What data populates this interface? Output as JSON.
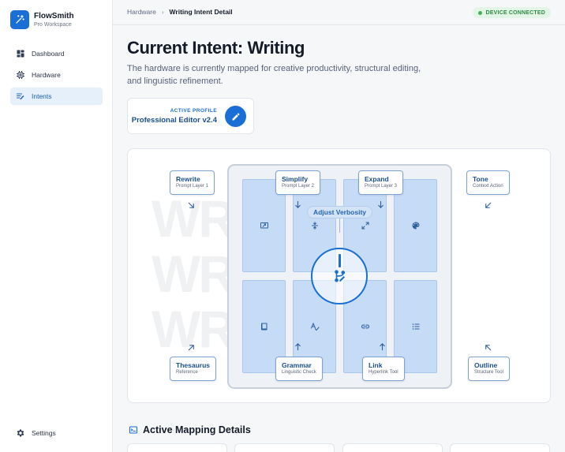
{
  "brand": {
    "name": "FlowSmith",
    "subtitle": "Pro Workspace",
    "logo_icon": "wand-icon",
    "accent": "#1a6fd6"
  },
  "nav": {
    "items": [
      {
        "label": "Dashboard",
        "icon": "dashboard-icon",
        "active": false
      },
      {
        "label": "Hardware",
        "icon": "chip-icon",
        "active": false
      },
      {
        "label": "Intents",
        "icon": "intents-icon",
        "active": true
      }
    ],
    "settings": {
      "label": "Settings",
      "icon": "gear-icon"
    }
  },
  "breadcrumb": {
    "parent": "Hardware",
    "separator": "›",
    "current": "Writing Intent Detail"
  },
  "status": {
    "label": "DEVICE CONNECTED",
    "color": "#3fb35a"
  },
  "page": {
    "title": "Current Intent: Writing",
    "description": "The hardware is currently mapped for creative productivity, structural editing, and linguistic refinement."
  },
  "profile": {
    "label": "ACTIVE PROFILE",
    "name": "Professional Editor v2.4",
    "edit_icon": "pencil-icon"
  },
  "device": {
    "watermark": [
      "WR",
      "WR",
      "WR"
    ],
    "dial": {
      "label": "Adjust Verbosity",
      "icon": "branch-edit-icon"
    },
    "keys_top": [
      "screen-share-icon",
      "format-line-spacing-icon",
      "expand-icon",
      "palette-icon"
    ],
    "keys_bottom": [
      "book-icon",
      "spellcheck-icon",
      "link-icon",
      "list-icon"
    ],
    "labels": {
      "rewrite": {
        "title": "Rewrite",
        "sub": "Prompt Layer 1"
      },
      "simplify": {
        "title": "Simplify",
        "sub": "Prompt Layer 2"
      },
      "expand": {
        "title": "Expand",
        "sub": "Prompt Layer 3"
      },
      "tone": {
        "title": "Tone",
        "sub": "Context Action"
      },
      "thesaurus": {
        "title": "Thesaurus",
        "sub": "Reference"
      },
      "grammar": {
        "title": "Grammar",
        "sub": "Linguistic Check"
      },
      "link": {
        "title": "Link",
        "sub": "Hyperlink Tool"
      },
      "outline": {
        "title": "Outline",
        "sub": "Structure Tool"
      }
    }
  },
  "mapping": {
    "title": "Active Mapping Details",
    "icon": "terminal-icon"
  }
}
